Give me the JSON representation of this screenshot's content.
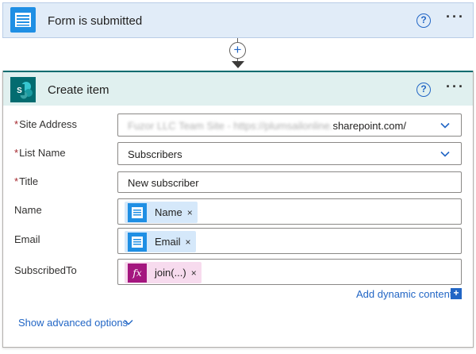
{
  "trigger": {
    "title": "Form is submitted",
    "icon": "forms-icon",
    "help_label": "?",
    "more_label": "···"
  },
  "connector": {
    "add_label": "+"
  },
  "action": {
    "title": "Create item",
    "icon": "sharepoint-icon",
    "help_label": "?",
    "more_label": "···",
    "fields": {
      "site_address": {
        "label": "Site Address",
        "required": "*",
        "value_blurred": "Fuzor LLC Team Site - https://plumsailonline.",
        "value_visible": "sharepoint.com/"
      },
      "list_name": {
        "label": "List Name",
        "required": "*",
        "value": "Subscribers"
      },
      "title": {
        "label": "Title",
        "required": "*",
        "value": "New subscriber"
      },
      "name": {
        "label": "Name",
        "token": "Name",
        "remove": "×"
      },
      "email": {
        "label": "Email",
        "token": "Email",
        "remove": "×"
      },
      "subscribed_to": {
        "label": "SubscribedTo",
        "token": "join(...)",
        "token_icon": "fx",
        "remove": "×"
      }
    },
    "add_dynamic": {
      "label": "Add dynamic content",
      "icon": "+"
    },
    "advanced": {
      "label": "Show advanced options"
    }
  },
  "colors": {
    "accent": "#2266c5",
    "forms_blue": "#1f8fe4",
    "sharepoint_teal": "#036c70",
    "expression_purple": "#a4167f"
  }
}
